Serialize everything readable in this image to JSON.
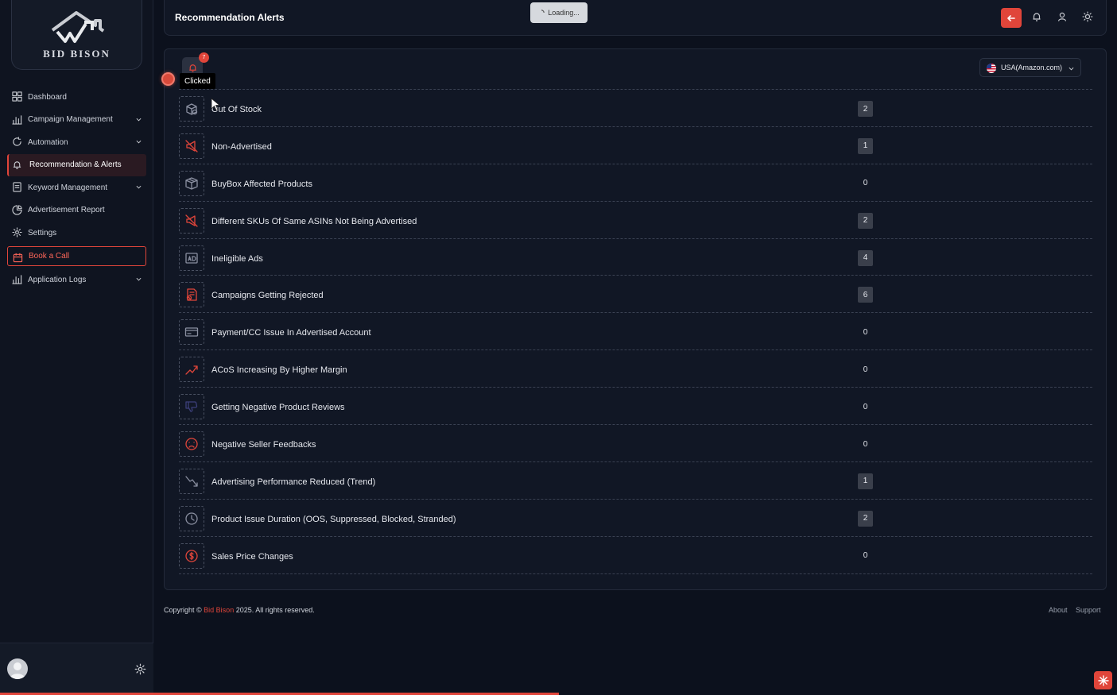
{
  "brand": {
    "logo_text": "BID BISON",
    "accent": "#e0453a"
  },
  "sidebar": {
    "items": [
      {
        "label": "Dashboard",
        "icon": "grid-icon",
        "chevron": false
      },
      {
        "label": "Campaign Management",
        "icon": "bar-chart-icon",
        "chevron": true
      },
      {
        "label": "Automation",
        "icon": "refresh-icon",
        "chevron": true
      },
      {
        "label": "Recommendation & Alerts",
        "icon": "bell-icon",
        "chevron": false,
        "active": true
      },
      {
        "label": "Keyword Management",
        "icon": "document-icon",
        "chevron": true
      },
      {
        "label": "Advertisement Report",
        "icon": "pie-chart-icon",
        "chevron": false
      },
      {
        "label": "Settings",
        "icon": "gear-icon",
        "chevron": false
      },
      {
        "label": "Book a Call",
        "icon": "calendar-icon",
        "chevron": false,
        "highlight": true
      },
      {
        "label": "Application Logs",
        "icon": "bar-chart-icon",
        "chevron": true
      }
    ]
  },
  "header": {
    "title": "Recommendation Alerts",
    "loading_text": "Loading...",
    "icons": [
      "back-arrow-icon",
      "bell-icon",
      "user-icon",
      "sun-icon"
    ]
  },
  "panel": {
    "bell_badge": "7",
    "tooltip": "Clicked",
    "country": "USA(Amazon.com)",
    "alerts": [
      {
        "label": "Out Of Stock",
        "count": "2",
        "boxed": true,
        "icon": "box-icon",
        "tone": "#8a8fa0"
      },
      {
        "label": "Non-Advertised",
        "count": "1",
        "boxed": true,
        "icon": "megaphone-off-icon",
        "tone": "#e0453a"
      },
      {
        "label": "BuyBox Affected Products",
        "count": "0",
        "boxed": false,
        "icon": "package-icon",
        "tone": "#8a8fa0"
      },
      {
        "label": "Different SKUs Of Same ASINs Not Being Advertised",
        "count": "2",
        "boxed": true,
        "icon": "megaphone-off-icon",
        "tone": "#e0453a"
      },
      {
        "label": "Ineligible Ads",
        "count": "4",
        "boxed": true,
        "icon": "ad-icon",
        "tone": "#8a8fa0"
      },
      {
        "label": "Campaigns Getting Rejected",
        "count": "6",
        "boxed": true,
        "icon": "rejected-doc-icon",
        "tone": "#e0453a"
      },
      {
        "label": "Payment/CC Issue In Advertised Account",
        "count": "0",
        "boxed": false,
        "icon": "credit-card-icon",
        "tone": "#8a8fa0"
      },
      {
        "label": "ACoS Increasing By Higher Margin",
        "count": "0",
        "boxed": false,
        "icon": "trend-up-icon",
        "tone": "#e0453a"
      },
      {
        "label": "Getting Negative Product Reviews",
        "count": "0",
        "boxed": false,
        "icon": "thumbs-down-icon",
        "tone": "#3c3f7a"
      },
      {
        "label": "Negative Seller Feedbacks",
        "count": "0",
        "boxed": false,
        "icon": "sad-face-icon",
        "tone": "#e0453a"
      },
      {
        "label": "Advertising Performance Reduced (Trend)",
        "count": "1",
        "boxed": true,
        "icon": "trend-down-icon",
        "tone": "#8a8fa0"
      },
      {
        "label": "Product Issue Duration (OOS, Suppressed, Blocked, Stranded)",
        "count": "2",
        "boxed": true,
        "icon": "clock-icon",
        "tone": "#8a8fa0"
      },
      {
        "label": "Sales Price Changes",
        "count": "0",
        "boxed": false,
        "icon": "dollar-circle-icon",
        "tone": "#e0453a"
      }
    ]
  },
  "footer": {
    "copyright_prefix": "Copyright ©",
    "brand": "Bid Bison",
    "copyright_suffix": "2025. All rights reserved.",
    "links": [
      "About",
      "Support"
    ]
  },
  "progress": {
    "fraction": 0.5
  }
}
